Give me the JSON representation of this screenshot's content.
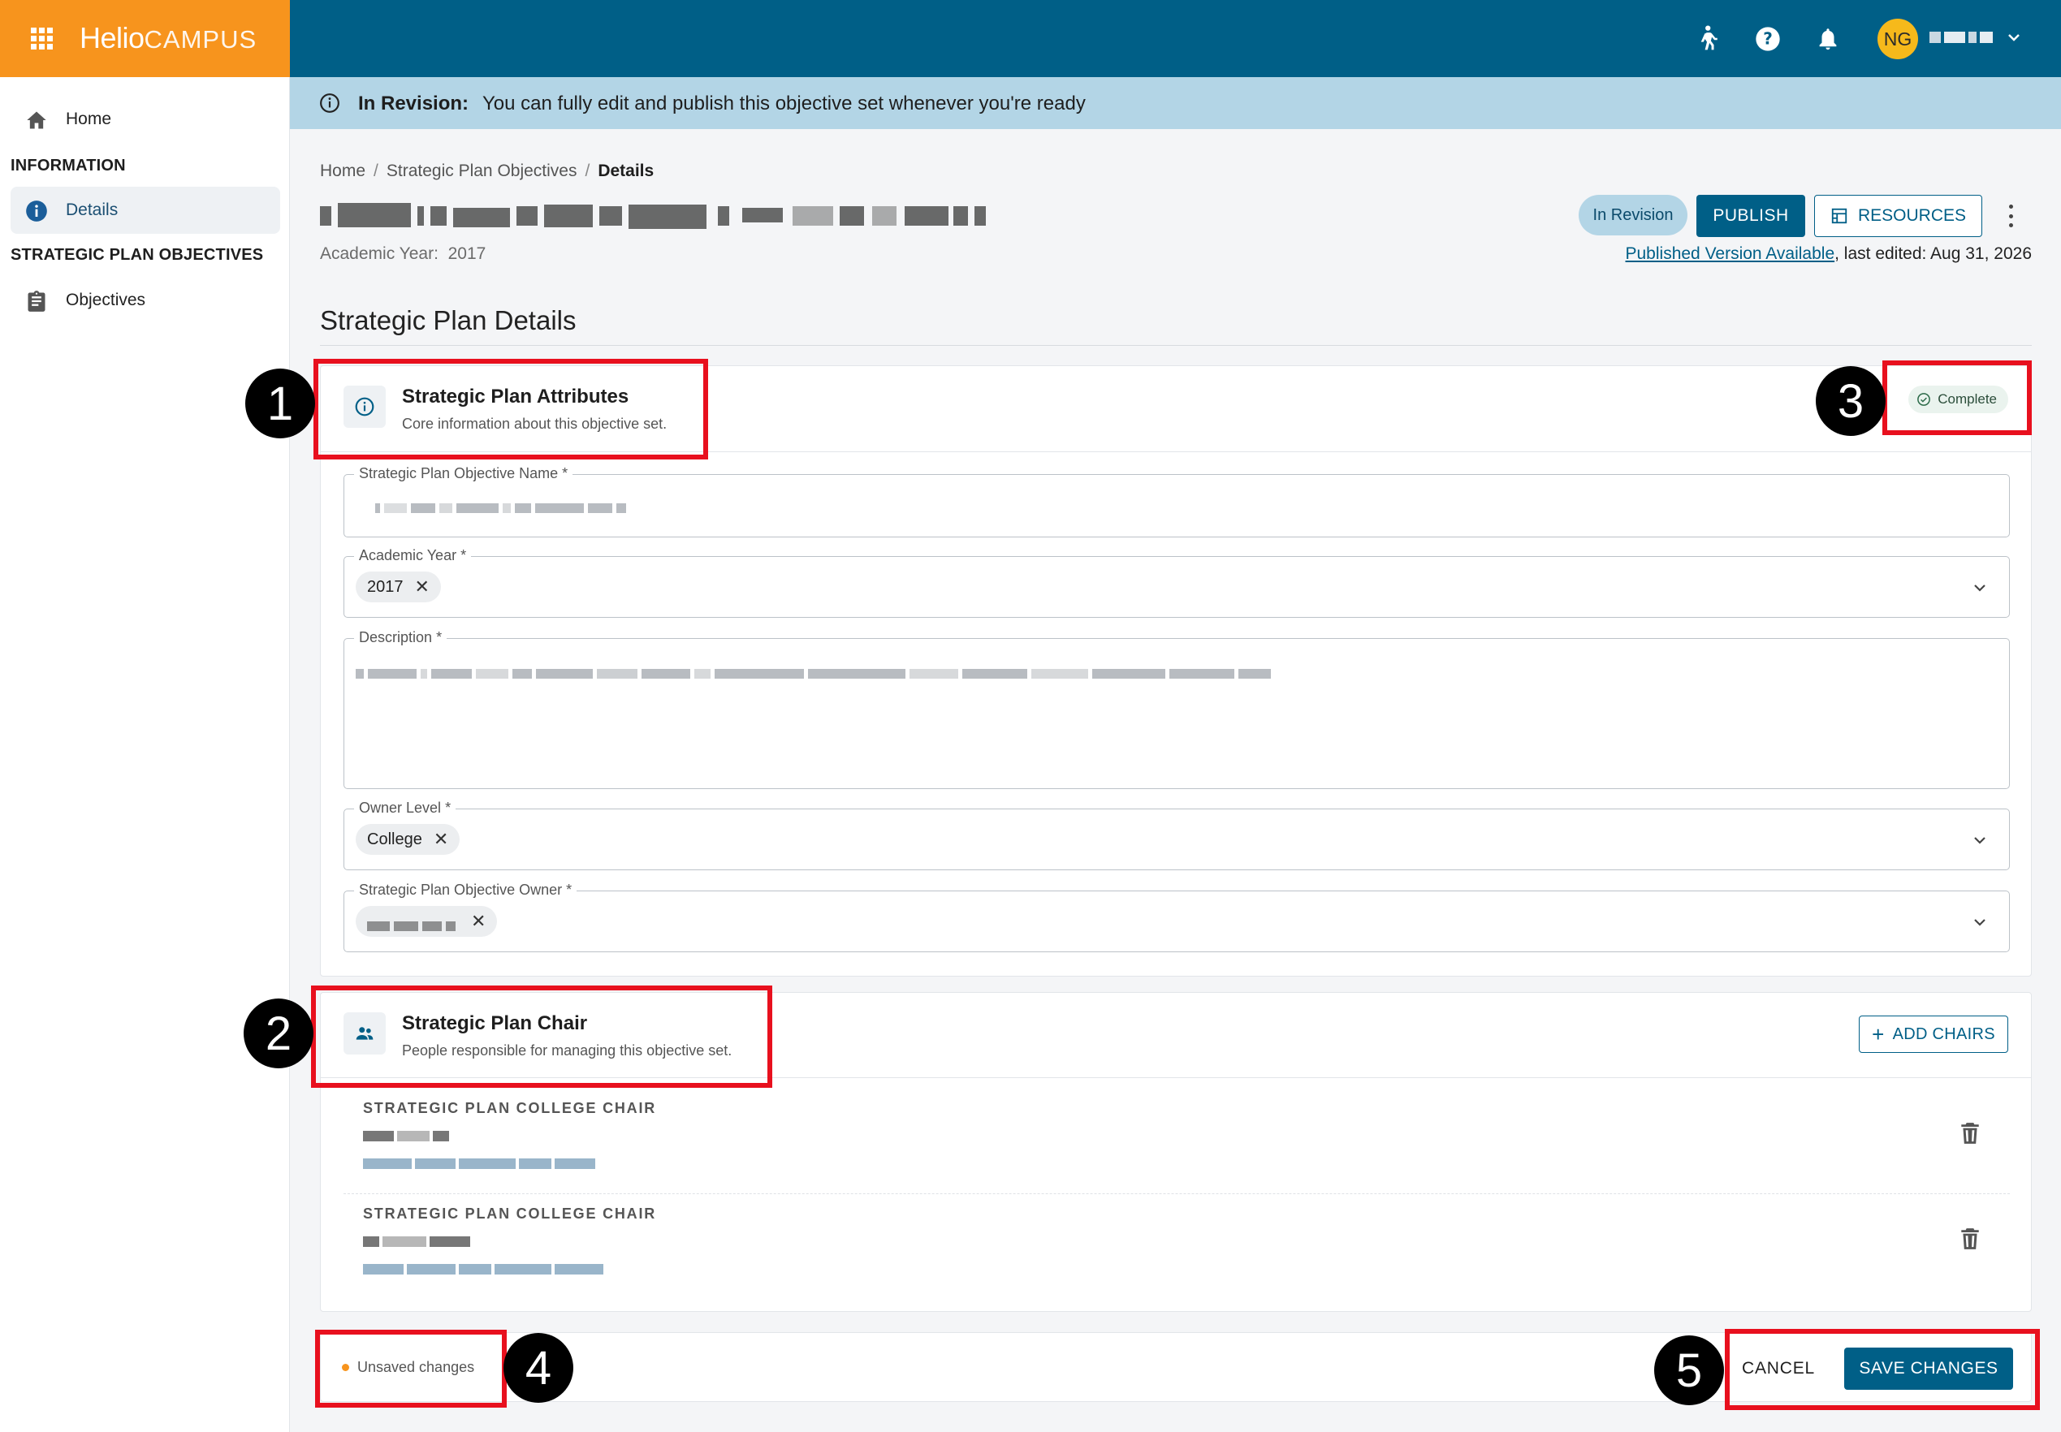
{
  "topbar": {
    "logo_bold": "Helio",
    "logo_light": "CAMPUS",
    "avatar_initials": "NG",
    "icons": [
      "apps-grid-icon",
      "accessibility-icon",
      "help-icon",
      "bell-icon",
      "chevron-down-icon"
    ],
    "brand_color": "#f7941d",
    "bar_color": "#005f87"
  },
  "sidebar": {
    "home_label": "Home",
    "info_heading": "INFORMATION",
    "details_label": "Details",
    "objectives_heading": "STRATEGIC PLAN OBJECTIVES",
    "objectives_label": "Objectives"
  },
  "banner": {
    "title": "In Revision:",
    "message": "You can fully edit and publish this objective set whenever you're ready"
  },
  "header": {
    "breadcrumb": [
      "Home",
      "Strategic Plan Objectives",
      "Details"
    ],
    "academic_year_label": "Academic Year:",
    "academic_year_value": "2017",
    "status_pill": "In Revision",
    "publish_label": "PUBLISH",
    "resources_label": "RESOURCES",
    "published_link": "Published Version Available",
    "last_edited": ", last edited: Aug 31, 2026"
  },
  "main": {
    "section_title": "Strategic Plan Details",
    "attributes": {
      "title": "Strategic Plan Attributes",
      "subtitle": "Core information about this objective set.",
      "status": "Complete",
      "fields": {
        "name_label": "Strategic Plan Objective Name",
        "year_label": "Academic Year",
        "year_chip": "2017",
        "description_label": "Description",
        "owner_level_label": "Owner Level",
        "owner_level_chip": "College",
        "owner_label": "Strategic Plan Objective Owner"
      },
      "required_marker": "*"
    },
    "chair": {
      "title": "Strategic Plan Chair",
      "subtitle": "People responsible for managing this objective set.",
      "add_label": "ADD CHAIRS",
      "rows": [
        {
          "role": "STRATEGIC PLAN COLLEGE CHAIR"
        },
        {
          "role": "STRATEGIC PLAN COLLEGE CHAIR"
        }
      ]
    }
  },
  "footer": {
    "unsaved_label": "Unsaved changes",
    "cancel_label": "CANCEL",
    "save_label": "SAVE CHANGES"
  },
  "annotations": [
    "1",
    "2",
    "3",
    "4",
    "5"
  ]
}
